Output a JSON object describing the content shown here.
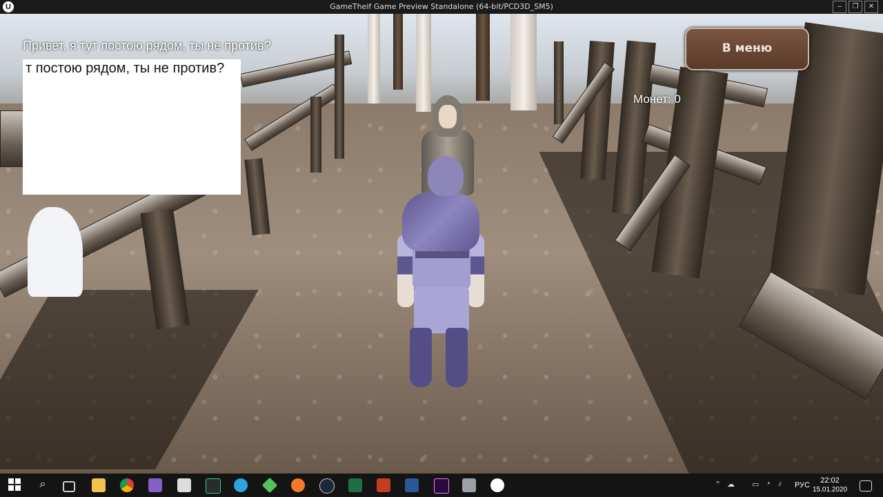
{
  "window": {
    "logo": "U",
    "title": "GameTheif Game Preview Standalone (64-bit/PCD3D_SM5)",
    "minimize": "–",
    "maximize": "❐",
    "close": "✕"
  },
  "hud": {
    "dialog_line": "Привет, я тут постою рядом, ты не против?",
    "dialog_box_text": "т постою рядом, ты не против?",
    "menu_button_label": "В меню",
    "coins_text": "Монет: 0"
  },
  "taskbar": {
    "apps": [
      "windows-start",
      "search",
      "task-view",
      "file-explorer",
      "chrome",
      "visual-studio",
      "unity",
      "pycharm",
      "telegram",
      "git-kraken",
      "blender",
      "steam",
      "excel",
      "powerpoint",
      "word",
      "premiere",
      "photos",
      "unreal-engine"
    ],
    "language": "РУС",
    "time": "22:02",
    "date": "15.01.2020"
  },
  "colors": {
    "menu_button": "#6b4a37",
    "ninja": "#8d86c0",
    "ground": "#9f8e7d"
  }
}
